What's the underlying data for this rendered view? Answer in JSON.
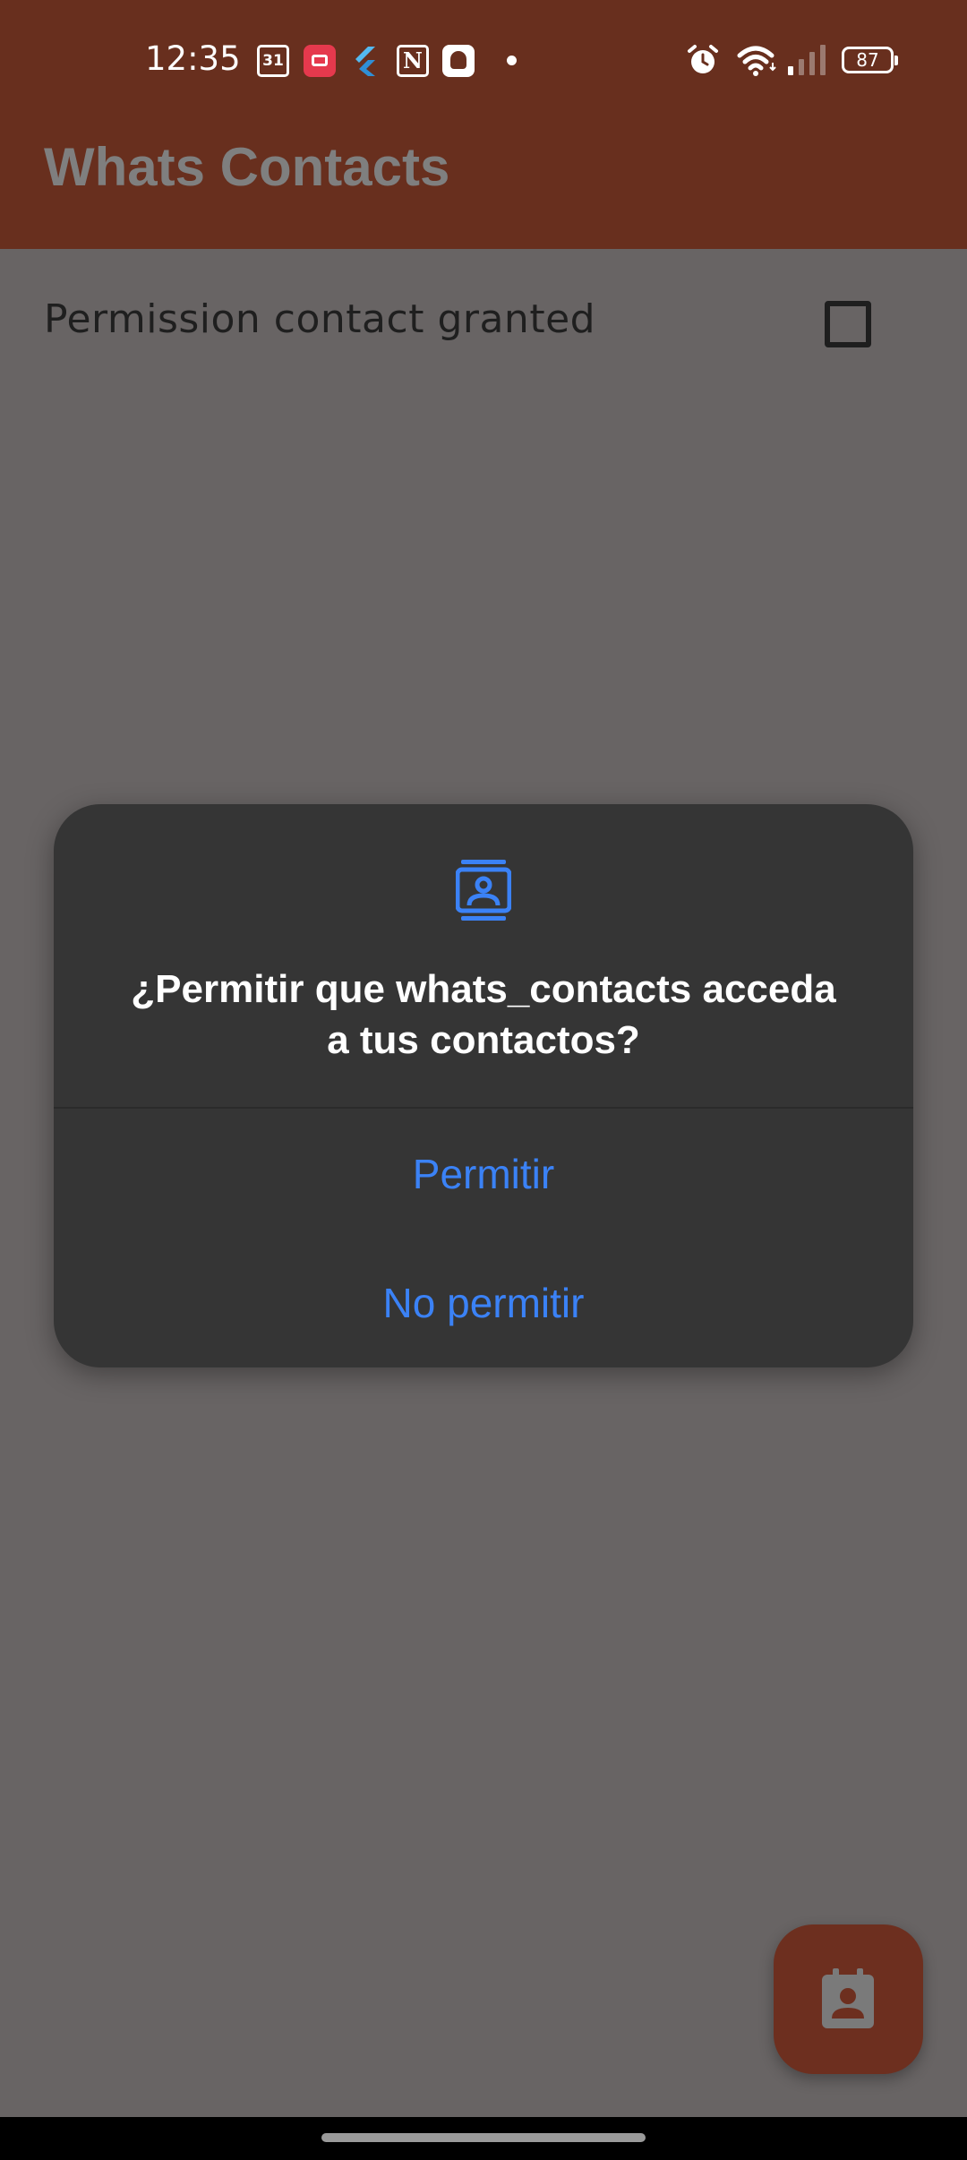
{
  "status_bar": {
    "time": "12:35",
    "calendar_day": "31",
    "notion_letter": "N",
    "battery": "87",
    "notification_icons": [
      "calendar-icon",
      "screen-record-icon",
      "flutter-icon",
      "notion-icon",
      "assistant-icon",
      "more-dot-icon"
    ],
    "system_icons": [
      "alarm-icon",
      "wifi-icon",
      "cell-signal-icon",
      "battery-icon"
    ]
  },
  "app_bar": {
    "title": "Whats Contacts"
  },
  "main": {
    "permission_label": "Permission contact granted",
    "permission_checked": false
  },
  "dialog": {
    "icon": "contacts-icon",
    "title": "¿Permitir que whats_contacts acceda a tus contactos?",
    "allow_label": "Permitir",
    "deny_label": "No permitir"
  },
  "fab": {
    "icon": "contact-calendar-icon"
  },
  "colors": {
    "app_bar": "#682f1e",
    "scrim_background": "#686464",
    "dialog_background": "#353535",
    "accent_blue": "#3b82f6",
    "fab": "#6d2f1f"
  }
}
